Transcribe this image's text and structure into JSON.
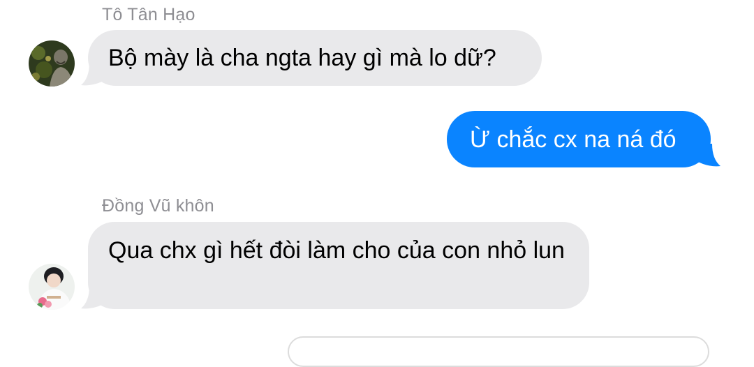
{
  "messages": [
    {
      "sender": "Tô Tân Hạo",
      "text": "Bộ mày là cha ngta hay gì mà lo dữ?"
    },
    {
      "text": "Ừ chắc cx na ná đó"
    },
    {
      "sender": "Đồng Vũ khôn",
      "text": "Qua chx gì hết  đòi làm cho của con nhỏ lun"
    }
  ],
  "colors": {
    "incoming_bubble": "#e9e9eb",
    "outgoing_bubble": "#0a84ff",
    "sender_name": "#8e8e93"
  },
  "icons": [
    "avatar-to-tan-hao",
    "avatar-dong-vu-khon"
  ]
}
